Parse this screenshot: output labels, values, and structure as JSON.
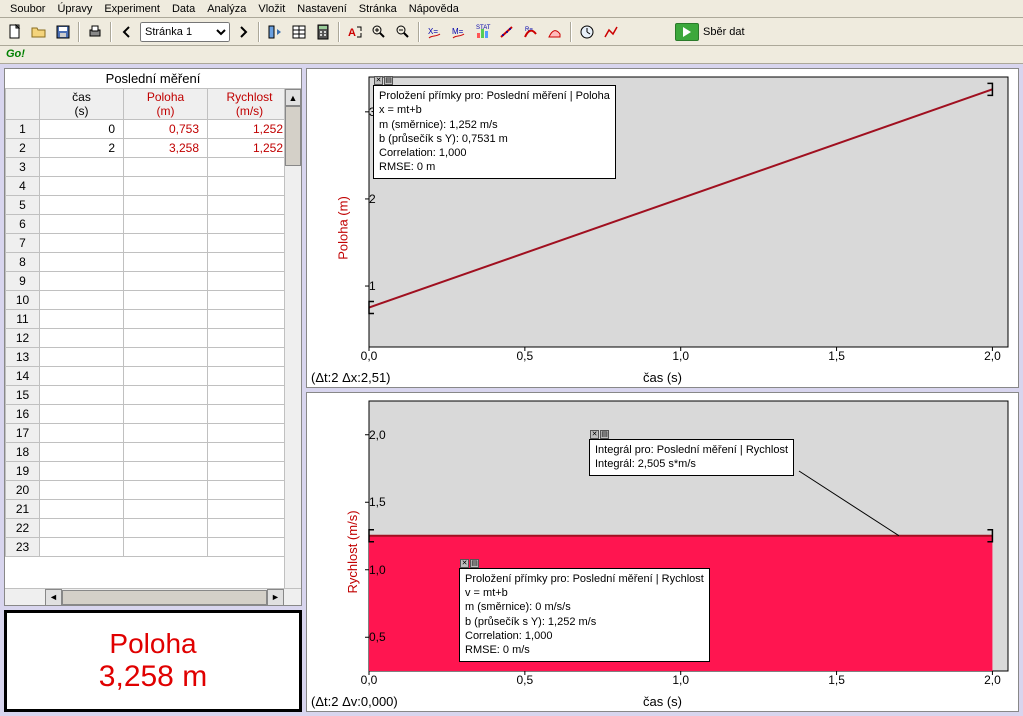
{
  "menu": [
    "Soubor",
    "Úpravy",
    "Experiment",
    "Data",
    "Analýza",
    "Vložit",
    "Nastavení",
    "Stránka",
    "Nápověda"
  ],
  "page_selector": "Stránka 1",
  "sber_dat": "Sběr dat",
  "go": "Go!",
  "table": {
    "title": "Poslední měření",
    "headers": {
      "cas": "čas",
      "cas_unit": "(s)",
      "poloha": "Poloha",
      "poloha_unit": "(m)",
      "rychlost": "Rychlost",
      "rychlost_unit": "(m/s)",
      "extra": "("
    },
    "rows": [
      {
        "n": 1,
        "cas": "0",
        "poloha": "0,753",
        "rychl": "1,252"
      },
      {
        "n": 2,
        "cas": "2",
        "poloha": "3,258",
        "rychl": "1,252"
      }
    ],
    "empty_count": 21
  },
  "display": {
    "label": "Poloha",
    "value": "3,258 m"
  },
  "chart_data": [
    {
      "type": "line",
      "ylabel": "Poloha (m)",
      "xlabel": "čas (s)",
      "delta": "(Δt:2 Δx:2,51)",
      "x": [
        0,
        2
      ],
      "y": [
        0.753,
        3.258
      ],
      "xticks": [
        "0,0",
        "0,5",
        "1,0",
        "1,5",
        "2,0"
      ],
      "yticks": [
        "1",
        "2",
        "3"
      ],
      "xlim": [
        0,
        2.05
      ],
      "ylim": [
        0.3,
        3.4
      ],
      "info": {
        "lines": [
          "Proložení přímky pro: Poslední měření | Poloha",
          "x = mt+b",
          "m (směrnice): 1,252 m/s",
          "b (průsečík s Y): 0,7531 m",
          "Correlation: 1,000",
          "RMSE: 0 m"
        ]
      }
    },
    {
      "type": "line",
      "ylabel": "Rychlost (m/s)",
      "xlabel": "čas (s)",
      "delta": "(Δt:2 Δv:0,000)",
      "x": [
        0,
        2
      ],
      "y": [
        1.252,
        1.252
      ],
      "xticks": [
        "0,0",
        "0,5",
        "1,0",
        "1,5",
        "2,0"
      ],
      "yticks": [
        "0,5",
        "1,0",
        "1,5",
        "2,0"
      ],
      "xlim": [
        0,
        2.05
      ],
      "ylim": [
        0.25,
        2.25
      ],
      "fill_to_zero": true,
      "info": {
        "lines": [
          "Proložení přímky pro: Poslední měření | Rychlost",
          "v = mt+b",
          "m (směrnice): 0 m/s/s",
          "b (průsečík s Y): 1,252 m/s",
          "Correlation: 1,000",
          "RMSE: 0 m/s"
        ]
      },
      "info2": {
        "lines": [
          "Integrál pro: Poslední měření | Rychlost",
          "Integrál: 2,505 s*m/s"
        ]
      }
    }
  ]
}
